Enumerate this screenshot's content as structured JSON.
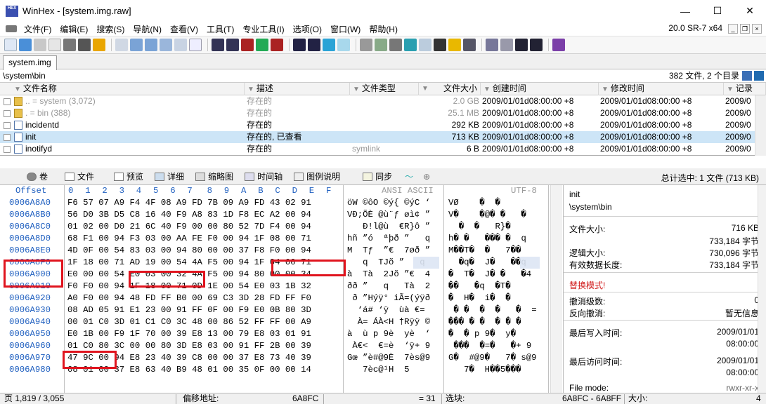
{
  "window": {
    "logo_text": "HEX",
    "title": "WinHex - [system.img.raw]",
    "minimize": "—",
    "maximize": "☐",
    "close": "✕"
  },
  "menu": {
    "items": [
      "文件(F)",
      "编辑(E)",
      "搜索(S)",
      "导航(N)",
      "查看(V)",
      "工具(T)",
      "专业工具(I)",
      "选项(O)",
      "窗口(W)",
      "帮助(H)"
    ],
    "version": "20.0 SR-7 x64",
    "mdi_min": "_",
    "mdi_restore": "❐",
    "mdi_close": "×"
  },
  "tabs": [
    "system.img"
  ],
  "path": {
    "current": "\\system\\bin",
    "count": "382 文件, 2 个目录"
  },
  "filelist": {
    "columns": [
      "文件名称",
      "描述",
      "文件类型",
      "文件大小",
      "创建时间",
      "修改时间",
      "记录"
    ],
    "rows": [
      {
        "name": "..  =  system (3,072)",
        "desc": "存在的",
        "type": "",
        "size": "2.0 GB",
        "ctime": "2009/01/01d08:00:00 +8",
        "mtime": "2009/01/01d08:00:00 +8",
        "rec": "2009/0",
        "icon": "folder",
        "grey": true,
        "selected": false
      },
      {
        "name": ".   =  bin (388)",
        "desc": "存在的",
        "type": "",
        "size": "25.1 MB",
        "ctime": "2009/01/01d08:00:00 +8",
        "mtime": "2009/01/01d08:00:00 +8",
        "rec": "2009/0",
        "icon": "folder",
        "grey": true,
        "selected": false
      },
      {
        "name": "incidentd",
        "desc": "存在的",
        "type": "",
        "size": "292 KB",
        "ctime": "2009/01/01d08:00:00 +8",
        "mtime": "2009/01/01d08:00:00 +8",
        "rec": "2009/0",
        "icon": "doc",
        "grey": false,
        "selected": false
      },
      {
        "name": "init",
        "desc": "存在的, 已查看",
        "type": "",
        "size": "713 KB",
        "ctime": "2009/01/01d08:00:00 +8",
        "mtime": "2009/01/01d08:00:00 +8",
        "rec": "2009/0",
        "icon": "doc",
        "grey": false,
        "selected": true
      },
      {
        "name": "inotifyd",
        "desc": "存在的",
        "type": "symlink",
        "size": "6 B",
        "ctime": "2009/01/01d08:00:00 +8",
        "mtime": "2009/01/01d08:00:00 +8",
        "rec": "2009/0",
        "icon": "doc",
        "grey": false,
        "selected": false
      }
    ]
  },
  "viewtabs": {
    "items": [
      "卷",
      "文件",
      "预览",
      "详细",
      "缩略图",
      "时间轴",
      "图例说明",
      "同步"
    ],
    "summary": "总计选中: 1 文件 (713 KB)"
  },
  "hex": {
    "header_offset": "Offset",
    "header_cols": [
      "0",
      "1",
      "2",
      "3",
      "4",
      "5",
      "6",
      "7",
      "8",
      "9",
      "A",
      "B",
      "C",
      "D",
      "E",
      "F"
    ],
    "header_ansi": "ANSI ASCII",
    "header_utf8": "UTF-8",
    "rows": [
      {
        "off": "0006A8A0",
        "bytes": "F6 57 07 A9 F4 4F 08 A9 FD 7B 09 A9 FD 43 02 91",
        "ansi": "öW ©ôO ©ý{ ©ýC ‘",
        "utf8": "VØ    �  � "
      },
      {
        "off": "0006A8B0",
        "bytes": "56 D0 3B D5 C8 16 40 F9 A8 83 1D F8 EC A2 00 94",
        "ansi": "VÐ;ÕÈ @ù¨ƒ øì¢ ”",
        "utf8": "V�    �@� �   � "
      },
      {
        "off": "0006A8C0",
        "bytes": "01 02 00 D0 21 6C 40 F9 00 00 80 52 7D F4 00 94",
        "ansi": "   Ð!l@ù  €R}ô ”",
        "utf8": "  �  �   R}� "
      },
      {
        "off": "0006A8D0",
        "bytes": "68 F1 00 94 F3 03 00 AA FE F0 00 94 1F 08 00 71",
        "ansi": "hñ ”ó  ªþð ”   q",
        "utf8": "h� �   ��� �  q"
      },
      {
        "off": "0006A8E0",
        "bytes": "4D 0F 00 54 83 03 00 94 80 00 00 37 F8 F0 00 94",
        "ansi": "M  Tƒ  ”€  7øð ”",
        "utf8": "M��T�  �   7�� "
      },
      {
        "off": "0006A8F0",
        "bytes": "1F 18 00 71 AD 19 00 54 4A F5 00 94 1F 04 00 71",
        "ansi": "   q­  TJõ ”   q",
        "utf8": "  �q�  J�   ��q"
      },
      {
        "off": "0006A900",
        "bytes": "E0 00 00 54 E0 03 00 32 4A F5 00 94 80 00 00 34",
        "ansi": "à  Tà  2Jõ ”€  4",
        "utf8": "�  T�  J� �   �4"
      },
      {
        "off": "0006A910",
        "bytes": "F0 F0 00 94 1F 18 00 71 0D 1E 00 54 E0 03 1B 32",
        "ansi": "ðð ”   q   Tà  2",
        "utf8": "��   �q  �T�  "
      },
      {
        "off": "0006A920",
        "bytes": "A0 F0 00 94 48 FD FF B0 00 69 C3 3D 28 FD FF F0",
        "ansi": " ð ”Hýÿ° iÃ=(ýÿð",
        "utf8": "�  H�  i�  � "
      },
      {
        "off": "0006A930",
        "bytes": "08 AD 05 91 E1 23 00 91 FF 0F 00 F9 E0 0B 80 3D",
        "ansi": " ­ ‘á# ‘ÿ  ùà €=",
        "utf8": " � �  �  �   �  ="
      },
      {
        "off": "0006A940",
        "bytes": "00 01 C0 3D 01 C1 C0 3C 48 00 86 52 FF FF 00 A9",
        "ansi": "  À= ÁÀ<H †Rÿÿ ©",
        "utf8": "��� � �  � � �"
      },
      {
        "off": "0006A950",
        "bytes": "E0 1B 00 F9 1F 70 00 39 E8 13 00 79 E8 03 01 91",
        "ansi": "à  ù p 9è  yè  ‘",
        "utf8": "�  � p 9�  y�  "
      },
      {
        "off": "0006A960",
        "bytes": "01 C0 80 3C 00 00 80 3D E8 03 00 91 FF 2B 00 39",
        "ansi": " À€<  €=è  ‘ÿ+ 9",
        "utf8": " ���  �=�   �+ 9"
      },
      {
        "off": "0006A970",
        "bytes": "47 9C 00 94 E8 23 40 39 C8 00 00 37 E8 73 40 39",
        "ansi": "Gœ ”è#@9È  7ès@9",
        "utf8": "G�  #@9�   7� s@9"
      },
      {
        "off": "0006A980",
        "bytes": "08 01 00 37 E8 63 40 B9 48 01 00 35 0F 00 00 14",
        "ansi": "   7èc@¹H  5    ",
        "utf8": "   7�  H��5���"
      }
    ]
  },
  "side": {
    "name": "init",
    "path": "\\system\\bin",
    "file_size_label": "文件大小:",
    "file_size": "716 KB",
    "file_size_bytes": "733,184 字节",
    "logical_size_label": "逻辑大小:",
    "logical_size": "730,096 字节",
    "valid_length_label": "有效数据长度:",
    "valid_length": "733,184 字节",
    "mode": "替换模式!",
    "undo_label": "撤消级数:",
    "undo_value": "0",
    "redo_label": "反向撤消:",
    "redo_value": "暂无信息",
    "last_write_label": "最后写入时间:",
    "last_write_date": "2009/01/01",
    "last_write_time": "08:00:00",
    "last_access_label": "最后访问时间:",
    "last_access_date": "2009/01/01",
    "last_access_time": "08:00:00",
    "file_mode_label": "File mode:",
    "file_mode_value": "rwxr-xr-x"
  },
  "status": {
    "page": "页 1,819 / 3,055",
    "offset_label": "偏移地址:",
    "offset_value": "6A8FC",
    "equals": "= 31",
    "selection_label": "选块:",
    "selection_value": "6A8FC - 6A8FF",
    "size_label": "大小:",
    "size_value": "4"
  },
  "colors": {
    "accent_red": "#e0141e",
    "offset_blue": "#2060c0",
    "selection_blue": "#cde5f7"
  }
}
